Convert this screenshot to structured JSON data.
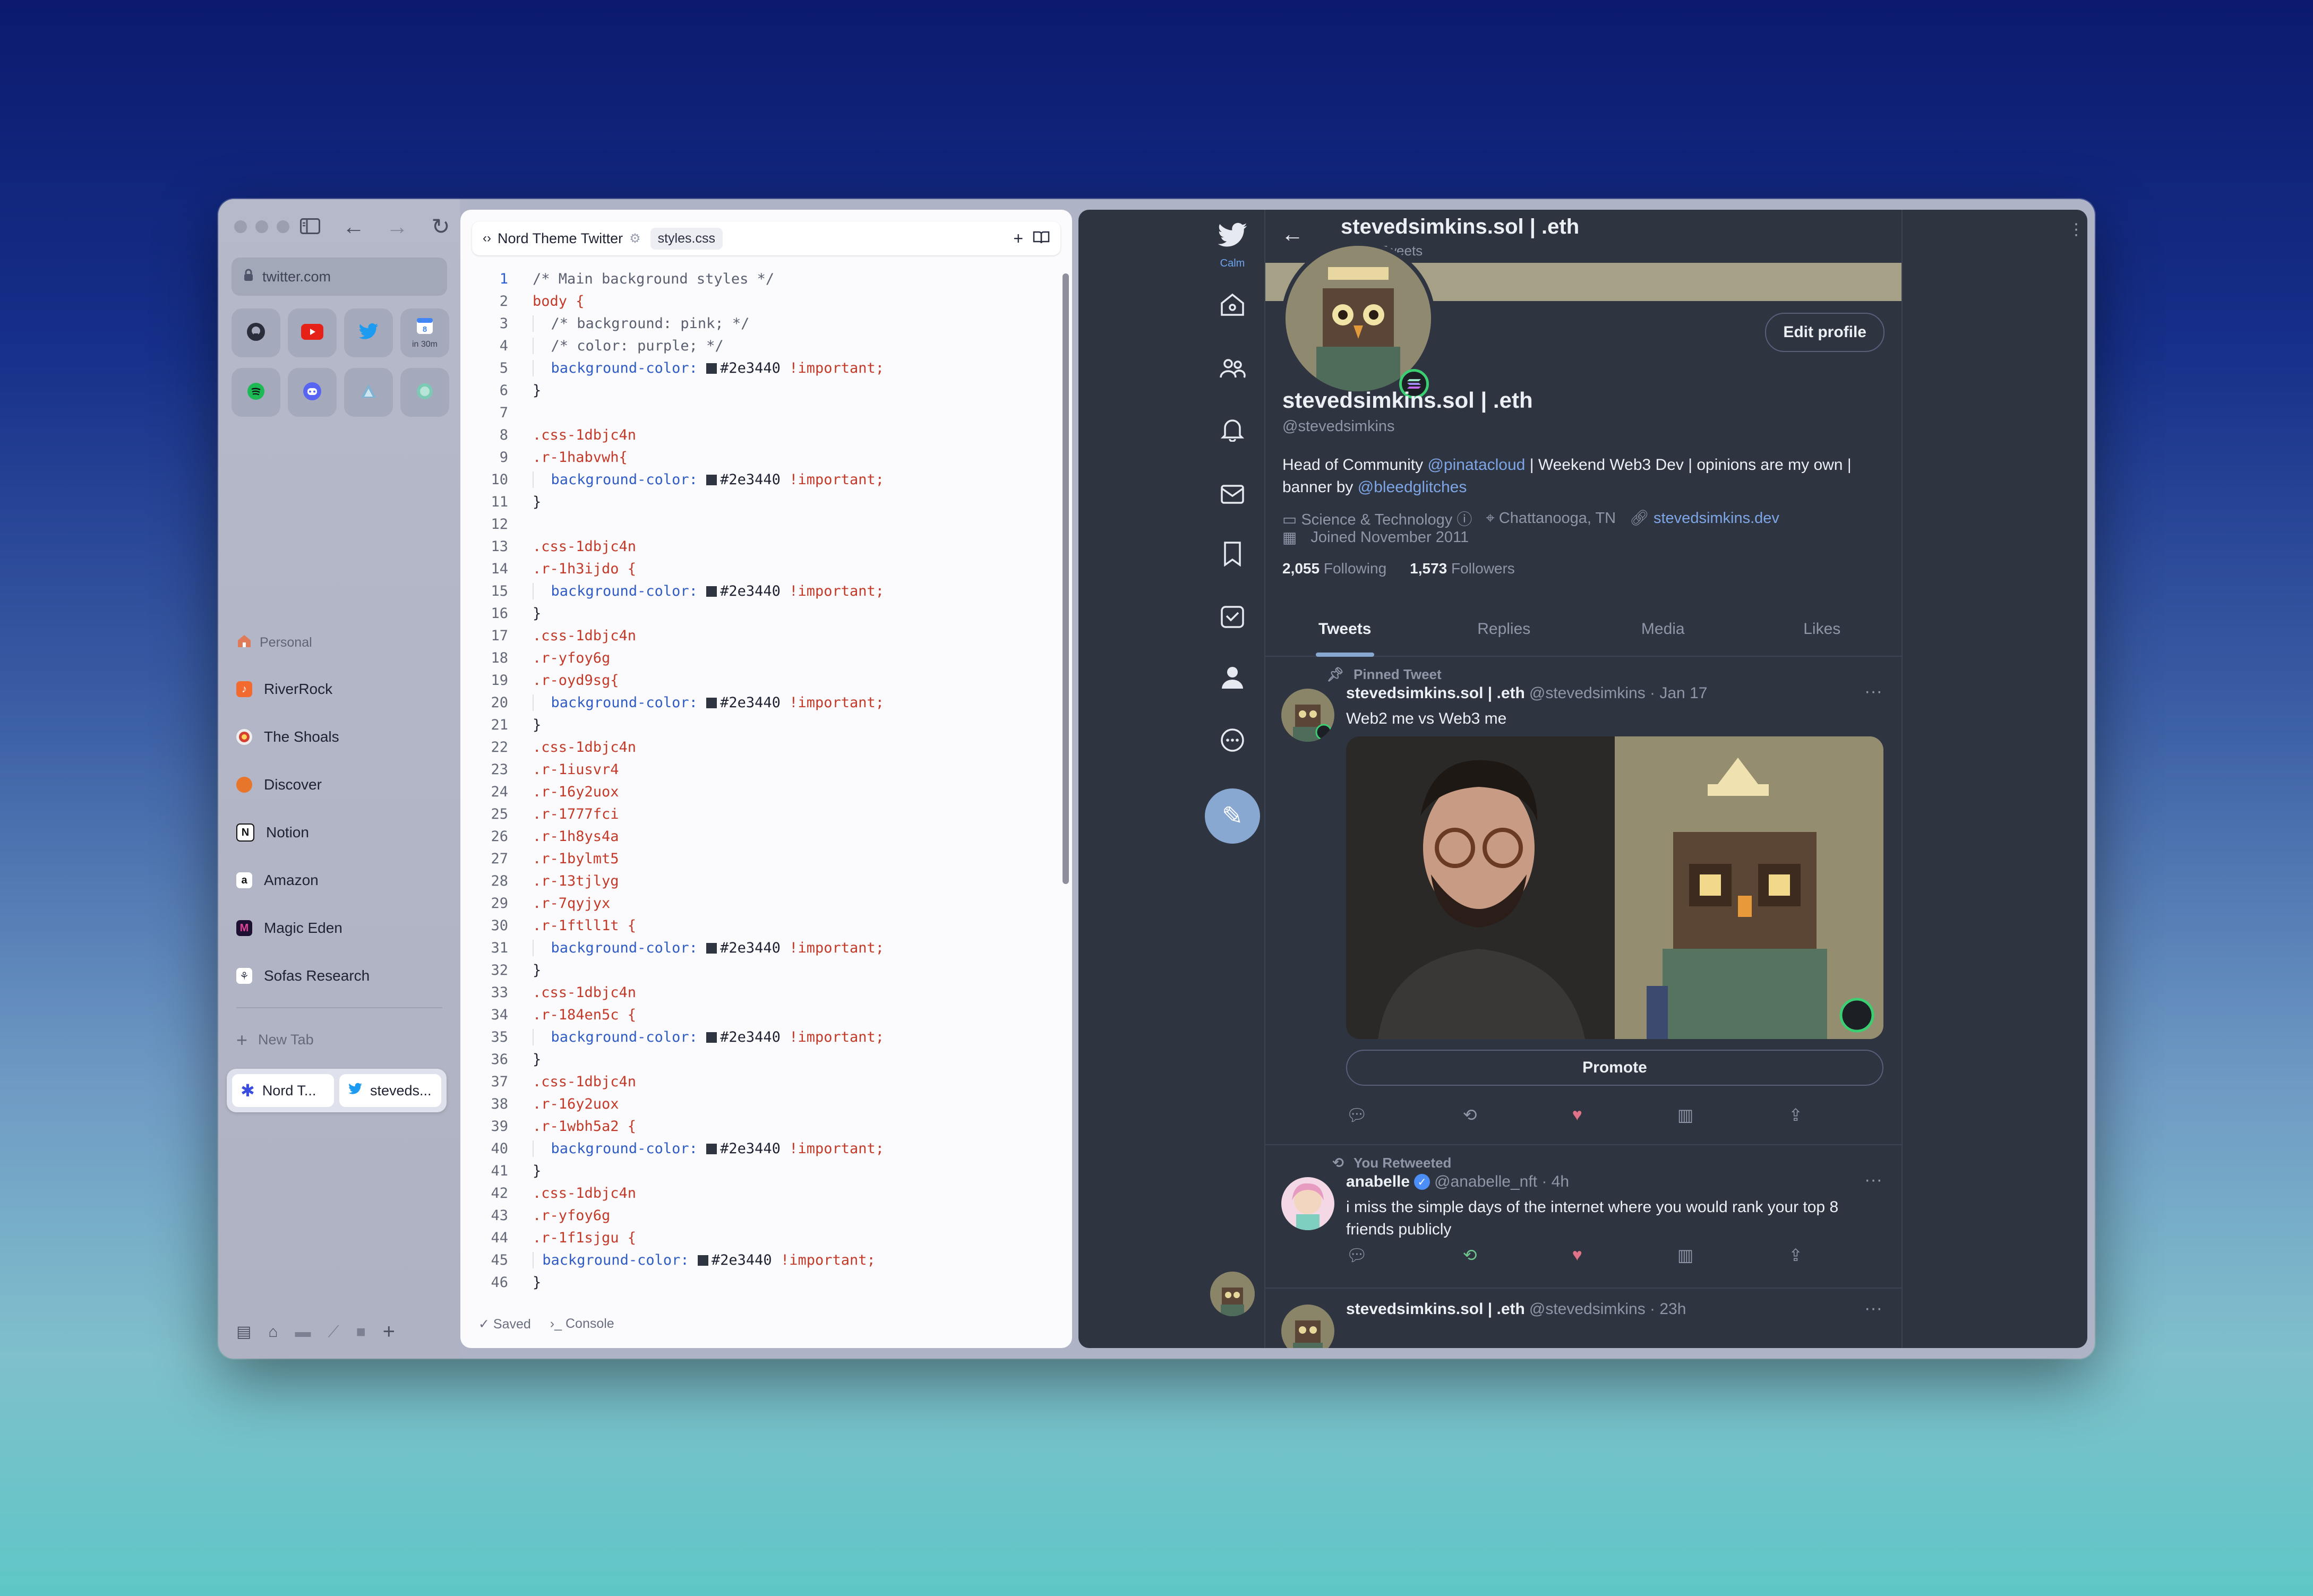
{
  "sidebar": {
    "url": "twitter.com",
    "favorites": [
      {
        "name": "github",
        "label": ""
      },
      {
        "name": "youtube",
        "label": ""
      },
      {
        "name": "twitter",
        "label": ""
      },
      {
        "name": "calendar",
        "label": "in 30m"
      },
      {
        "name": "spotify",
        "label": ""
      },
      {
        "name": "discord",
        "label": ""
      },
      {
        "name": "triangle-app",
        "label": ""
      },
      {
        "name": "circle-app",
        "label": ""
      }
    ],
    "section": "Personal",
    "tabs": [
      {
        "label": "RiverRock",
        "color": "#f26a2e",
        "glyph": "♪"
      },
      {
        "label": "The Shoals",
        "color": "#d54030",
        "glyph": "●"
      },
      {
        "label": "Discover",
        "color": "#e8762a",
        "glyph": "●"
      },
      {
        "label": "Notion",
        "color": "#2d2d2d",
        "glyph": "N"
      },
      {
        "label": "Amazon",
        "color": "#222222",
        "glyph": "a"
      },
      {
        "label": "Magic Eden",
        "color": "#d03c8e",
        "glyph": "M"
      },
      {
        "label": "Sofas Research",
        "color": "#3b3f55",
        "glyph": "⚘"
      }
    ],
    "new_tab": "New Tab",
    "split": {
      "left": "Nord T...",
      "right": "steveds..."
    }
  },
  "editor": {
    "tab_title": "Nord Theme Twitter",
    "file_chip": "styles.css",
    "status_saved": "Saved",
    "status_console": "Console",
    "swatch_color": "#2e3440",
    "lines": [
      {
        "t": "comment",
        "text": "/* Main background styles */"
      },
      {
        "t": "selector",
        "text": "body {"
      },
      {
        "t": "comment-in",
        "text": "/* background: pink; */"
      },
      {
        "t": "comment-in",
        "text": "/* color: purple; */"
      },
      {
        "t": "decl",
        "prop": "background-color:",
        "val": "#2e3440",
        "imp": "!important;"
      },
      {
        "t": "plain",
        "text": "}"
      },
      {
        "t": "plain",
        "text": ""
      },
      {
        "t": "selector",
        "text": ".css-1dbjc4n"
      },
      {
        "t": "selector",
        "text": ".r-1habvwh{"
      },
      {
        "t": "decl",
        "prop": "background-color:",
        "val": "#2e3440",
        "imp": "!important;"
      },
      {
        "t": "plain",
        "text": "}"
      },
      {
        "t": "plain",
        "text": ""
      },
      {
        "t": "selector",
        "text": ".css-1dbjc4n"
      },
      {
        "t": "selector",
        "text": ".r-1h3ijdo {"
      },
      {
        "t": "decl",
        "prop": "background-color:",
        "val": "#2e3440",
        "imp": "!important;"
      },
      {
        "t": "plain",
        "text": "}"
      },
      {
        "t": "selector",
        "text": ".css-1dbjc4n"
      },
      {
        "t": "selector",
        "text": ".r-yfoy6g"
      },
      {
        "t": "selector",
        "text": ".r-oyd9sg{"
      },
      {
        "t": "decl",
        "prop": "background-color:",
        "val": "#2e3440",
        "imp": "!important;"
      },
      {
        "t": "plain",
        "text": "}"
      },
      {
        "t": "selector",
        "text": ".css-1dbjc4n"
      },
      {
        "t": "selector",
        "text": ".r-1iusvr4"
      },
      {
        "t": "selector",
        "text": ".r-16y2uox"
      },
      {
        "t": "selector",
        "text": ".r-1777fci"
      },
      {
        "t": "selector",
        "text": ".r-1h8ys4a"
      },
      {
        "t": "selector",
        "text": ".r-1bylmt5"
      },
      {
        "t": "selector",
        "text": ".r-13tjlyg"
      },
      {
        "t": "selector",
        "text": ".r-7qyjyx"
      },
      {
        "t": "selector",
        "text": ".r-1ftll1t {"
      },
      {
        "t": "decl",
        "prop": "background-color:",
        "val": "#2e3440",
        "imp": "!important;"
      },
      {
        "t": "plain",
        "text": "}"
      },
      {
        "t": "selector",
        "text": ".css-1dbjc4n"
      },
      {
        "t": "selector",
        "text": ".r-184en5c {"
      },
      {
        "t": "decl",
        "prop": "background-color:",
        "val": "#2e3440",
        "imp": "!important;"
      },
      {
        "t": "plain",
        "text": "}"
      },
      {
        "t": "selector",
        "text": ".css-1dbjc4n"
      },
      {
        "t": "selector",
        "text": ".r-16y2uox"
      },
      {
        "t": "selector",
        "text": ".r-1wbh5a2 {"
      },
      {
        "t": "decl",
        "prop": "background-color:",
        "val": "#2e3440",
        "imp": "!important;"
      },
      {
        "t": "plain",
        "text": "}"
      },
      {
        "t": "selector",
        "text": ".css-1dbjc4n"
      },
      {
        "t": "selector",
        "text": ".r-yfoy6g"
      },
      {
        "t": "selector",
        "text": ".r-1f1sjgu {"
      },
      {
        "t": "decl-noindent",
        "prop": "background-color:",
        "val": "#2e3440",
        "imp": "!important;"
      },
      {
        "t": "plain",
        "text": "}"
      }
    ]
  },
  "twitter": {
    "calm_label": "Calm",
    "header_name": "stevedsimkins.sol | .eth",
    "header_count": "9,768 Tweets",
    "edit_profile": "Edit profile",
    "name": "stevedsimkins.sol | .eth",
    "handle": "@stevedsimkins",
    "bio_parts": [
      {
        "text": "Head of Community ",
        "link": false
      },
      {
        "text": "@pinatacloud",
        "link": true
      },
      {
        "text": " | Weekend Web3 Dev | opinions are my own | banner by ",
        "link": false
      },
      {
        "text": "@bleedglitches",
        "link": true
      }
    ],
    "category": "Science & Technology",
    "location": "Chattanooga, TN",
    "website": "stevedsimkins.dev",
    "joined": "Joined November 2011",
    "following_count": "2,055",
    "following_label": "Following",
    "followers_count": "1,573",
    "followers_label": "Followers",
    "tabs": [
      "Tweets",
      "Replies",
      "Media",
      "Likes"
    ],
    "tweets": [
      {
        "context": "Pinned Tweet",
        "name": "stevedsimkins.sol | .eth",
        "meta": "@stevedsimkins · Jan 17",
        "text": "Web2 me vs Web3 me",
        "promote": "Promote"
      },
      {
        "context": "You Retweeted",
        "name": "anabelle",
        "meta": "@anabelle_nft · 4h",
        "text": "i miss the simple days of the internet where you would rank your top 8 friends publicly"
      },
      {
        "context": "",
        "name": "stevedsimkins.sol | .eth",
        "meta": "@stevedsimkins · 23h",
        "text": ""
      }
    ]
  }
}
